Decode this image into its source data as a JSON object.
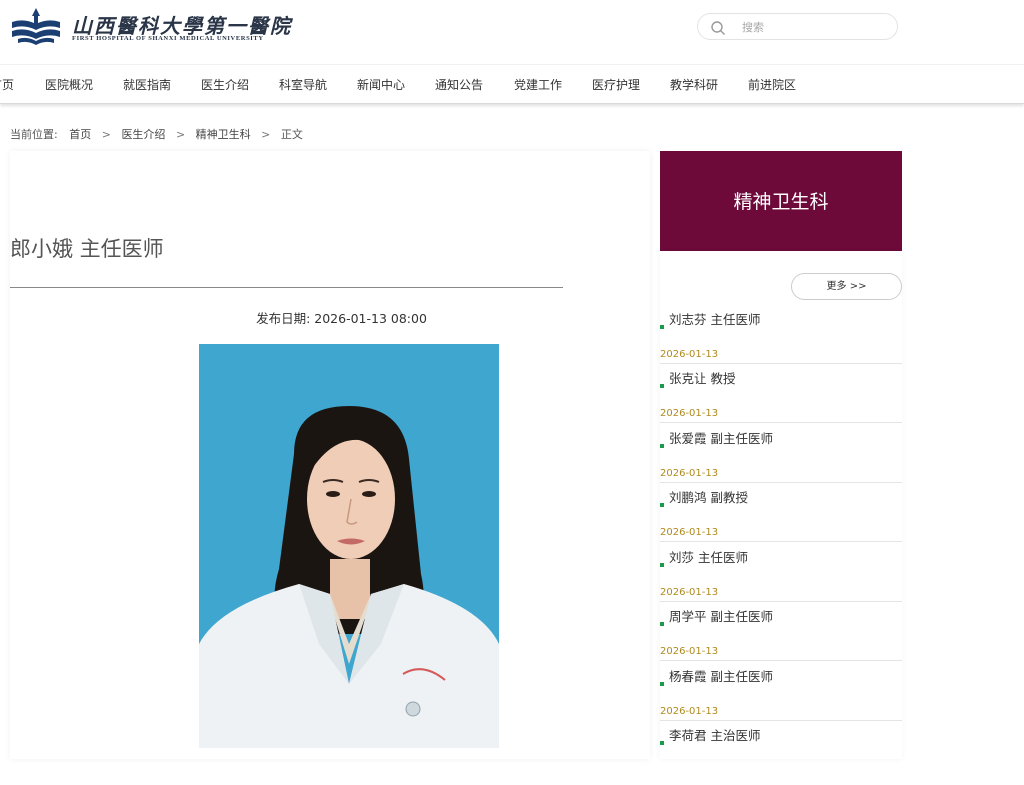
{
  "header": {
    "logo_cn": "山西醫科大學第一醫院",
    "logo_en": "FIRST HOSPITAL OF SHANXI MEDICAL UNIVERSITY",
    "search_placeholder": "搜索"
  },
  "nav": {
    "items": [
      "首页",
      "医院概况",
      "就医指南",
      "医生介绍",
      "科室导航",
      "新闻中心",
      "通知公告",
      "党建工作",
      "医疗护理",
      "教学科研",
      "前进院区"
    ]
  },
  "breadcrumb": {
    "label": "当前位置:",
    "items": [
      "首页",
      "医生介绍",
      "精神卫生科",
      "正文"
    ],
    "separator": ">"
  },
  "article": {
    "title": "郎小娥 主任医师",
    "date_label": "发布日期:",
    "date": "2026-01-13 08:00"
  },
  "sidebar": {
    "title": "精神卫生科",
    "more_label": "更多 >>",
    "items": [
      {
        "name": "刘志芬 主任医师",
        "date": "2026-01-13"
      },
      {
        "name": "张克让 教授",
        "date": "2026-01-13"
      },
      {
        "name": "张爱霞 副主任医师",
        "date": "2026-01-13"
      },
      {
        "name": "刘鹏鸿 副教授",
        "date": "2026-01-13"
      },
      {
        "name": "刘莎 主任医师",
        "date": "2026-01-13"
      },
      {
        "name": "周学平 副主任医师",
        "date": "2026-01-13"
      },
      {
        "name": "杨春霞 副主任医师",
        "date": "2026-01-13"
      },
      {
        "name": "李荷君 主治医师",
        "date": ""
      }
    ]
  },
  "colors": {
    "sidebar_header_bg": "#6d0a3a",
    "bullet": "#1a9a4a",
    "date_text": "#b08a1e",
    "photo_bg": "#3fa6cf"
  }
}
